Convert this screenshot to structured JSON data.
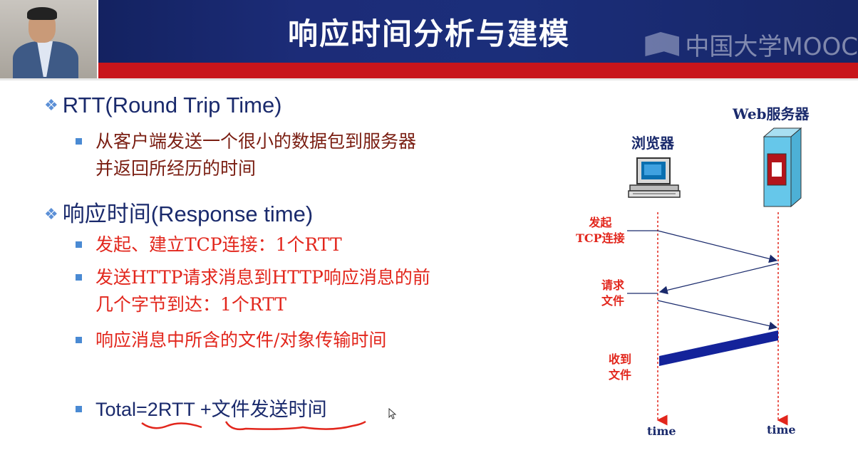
{
  "slide": {
    "title": "响应时间分析与建模",
    "watermark": "中国大学MOOC"
  },
  "bullets": {
    "rtt_heading": "RTT(Round Trip Time)",
    "rtt_desc_line1": "从客户端发送一个很小的数据包到服务器",
    "rtt_desc_line2": "并返回所经历的时间",
    "resp_heading": "响应时间(Response time)",
    "item1": "发起、建立TCP连接：1个RTT",
    "item2_line1": "发送HTTP请求消息到HTTP响应消息的前",
    "item2_line2": "几个字节到达：1个RTT",
    "item3": "响应消息中所含的文件/对象传输时间",
    "total": "Total=2RTT +文件发送时间"
  },
  "diagram": {
    "server_label": "Web服务器",
    "browser_label": "浏览器",
    "initiate_line1": "发起",
    "initiate_line2": "TCP连接",
    "request_line1": "请求",
    "request_line2": "文件",
    "receive_line1": "收到",
    "receive_line2": "文件",
    "time_left": "time",
    "time_right": "time"
  },
  "colors": {
    "header_blue": "#1b2e7a",
    "header_red": "#c8151b",
    "navy_text": "#1a2a6c",
    "brown_text": "#7a1e12",
    "red_text": "#e2261c",
    "bullet_blue": "#4a8ad3"
  },
  "icons": [
    "diamond-bullet-icon",
    "square-bullet-icon",
    "computer-icon",
    "server-icon",
    "mouse-cursor-icon",
    "mooc-logo-icon"
  ]
}
